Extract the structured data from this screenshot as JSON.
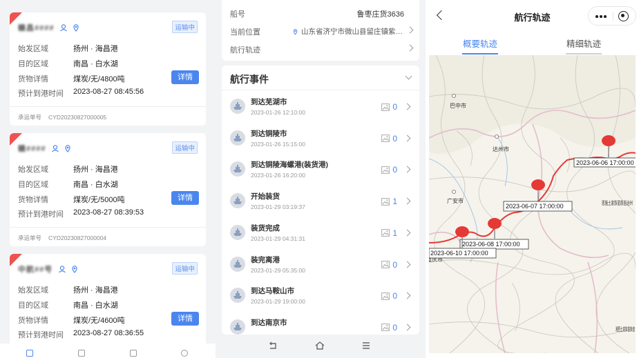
{
  "shipments": [
    {
      "ship_name": "赣昌####",
      "status": "运输中",
      "origin_label": "始发区域",
      "origin": "扬州 · 海昌港",
      "dest_label": "目的区域",
      "dest": "南昌 · 白水湖",
      "cargo_label": "货物详情",
      "cargo": "煤炭/无/4800吨",
      "eta_label": "预计到港时间",
      "eta": "2023-08-27 08:45:56",
      "detail_label": "详情",
      "order_label": "承运单号",
      "order_no": "CYD20230827000005"
    },
    {
      "ship_name": "赣####",
      "status": "运输中",
      "origin_label": "始发区域",
      "origin": "扬州 · 海昌港",
      "dest_label": "目的区域",
      "dest": "南昌 · 白水湖",
      "cargo_label": "货物详情",
      "cargo": "煤炭/无/5000吨",
      "eta_label": "预计到港时间",
      "eta": "2023-08-27 08:39:53",
      "detail_label": "详情",
      "order_label": "承运单号",
      "order_no": "CYD20230827000004"
    },
    {
      "ship_name": "中航##号",
      "status": "运输中",
      "origin_label": "始发区域",
      "origin": "扬州 · 海昌港",
      "dest_label": "目的区域",
      "dest": "南昌 · 白水湖",
      "cargo_label": "货物详情",
      "cargo": "煤炭/无/4600吨",
      "eta_label": "预计到港时间",
      "eta": "2023-08-27 08:36:55",
      "detail_label": "详情"
    }
  ],
  "voyage": {
    "ship_no_label": "船号",
    "ship_no": "鲁枣庄货3636",
    "location_label": "当前位置",
    "location": "山东省济宁市微山县留庄镇紫…",
    "track_label": "航行轨迹",
    "events_title": "航行事件",
    "events": [
      {
        "title": "到达芜湖市",
        "time": "2023-01-26 12:10:00",
        "count": "0"
      },
      {
        "title": "到达铜陵市",
        "time": "2023-01-26 15:15:00",
        "count": "0"
      },
      {
        "title": "到达铜陵海螺港(装货港)",
        "time": "2023-01-26 16:20:00",
        "count": "0"
      },
      {
        "title": "开始装货",
        "time": "2023-01-29 03:19:37",
        "count": "1"
      },
      {
        "title": "装货完成",
        "time": "2023-01-29 04:31:31",
        "count": "1"
      },
      {
        "title": "装完离港",
        "time": "2023-01-29 05:35:00",
        "count": "0"
      },
      {
        "title": "到达马鞍山市",
        "time": "2023-01-29 19:00:00",
        "count": "0"
      },
      {
        "title": "到达南京市",
        "time": "",
        "count": "0"
      }
    ]
  },
  "track": {
    "title": "航行轨迹",
    "tabs": [
      "概要轨迹",
      "精细轨迹"
    ],
    "markers": [
      "2023-06-06 17:00:00",
      "2023-06-07 17:00:00",
      "2023-06-08 17:00:00",
      "2023-06-10 17:00:00"
    ],
    "cities": [
      "巴中市",
      "达州市",
      "广安市",
      "重庆市",
      "恩施土家族苗族自治州",
      "湘西土家族苗族自"
    ],
    "route_color": "#e53935",
    "accent_color": "#4a86ee"
  }
}
